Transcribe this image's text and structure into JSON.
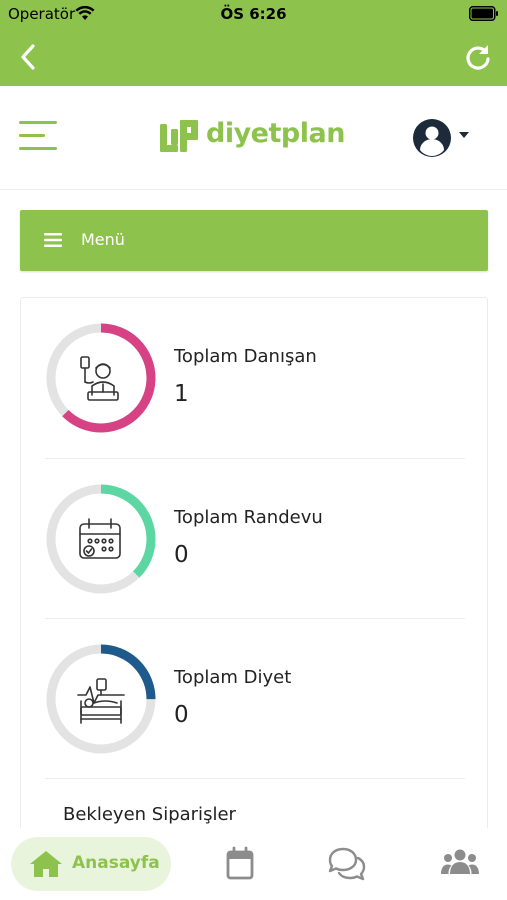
{
  "status_bar": {
    "carrier": "Operatör",
    "time": "ÖS 6:26",
    "icons": [
      "wifi-icon",
      "battery-icon"
    ]
  },
  "nav_bar": {
    "icons": [
      "back-chevron-icon",
      "refresh-icon"
    ]
  },
  "header": {
    "logo_text": "diyetplan",
    "icons": [
      "hamburger-icon",
      "user-avatar-icon",
      "caret-down-icon"
    ]
  },
  "menu": {
    "label": "Menü"
  },
  "stats": [
    {
      "title": "Toplam Danışan",
      "value": "1",
      "ring_color": "#d64283",
      "ring_fraction": 0.625,
      "icon": "patient-iv-icon"
    },
    {
      "title": "Toplam Randevu",
      "value": "0",
      "ring_color": "#5cd6a3",
      "ring_fraction": 0.375,
      "icon": "calendar-icon"
    },
    {
      "title": "Toplam Diyet",
      "value": "0",
      "ring_color": "#1f5a8d",
      "ring_fraction": 0.25,
      "icon": "hospital-bed-icon"
    }
  ],
  "pending_orders_title": "Bekleyen Siparişler",
  "tab_bar": {
    "home_label": "Anasayfa",
    "icons": [
      "home-icon",
      "calendar-icon",
      "chat-icon",
      "users-icon"
    ]
  },
  "colors": {
    "brand_green": "#8dc34d",
    "ring_track": "#e3e3e3",
    "home_tab_bg": "#e9f4dc",
    "tab_icon_gray": "#8c8c8c"
  }
}
